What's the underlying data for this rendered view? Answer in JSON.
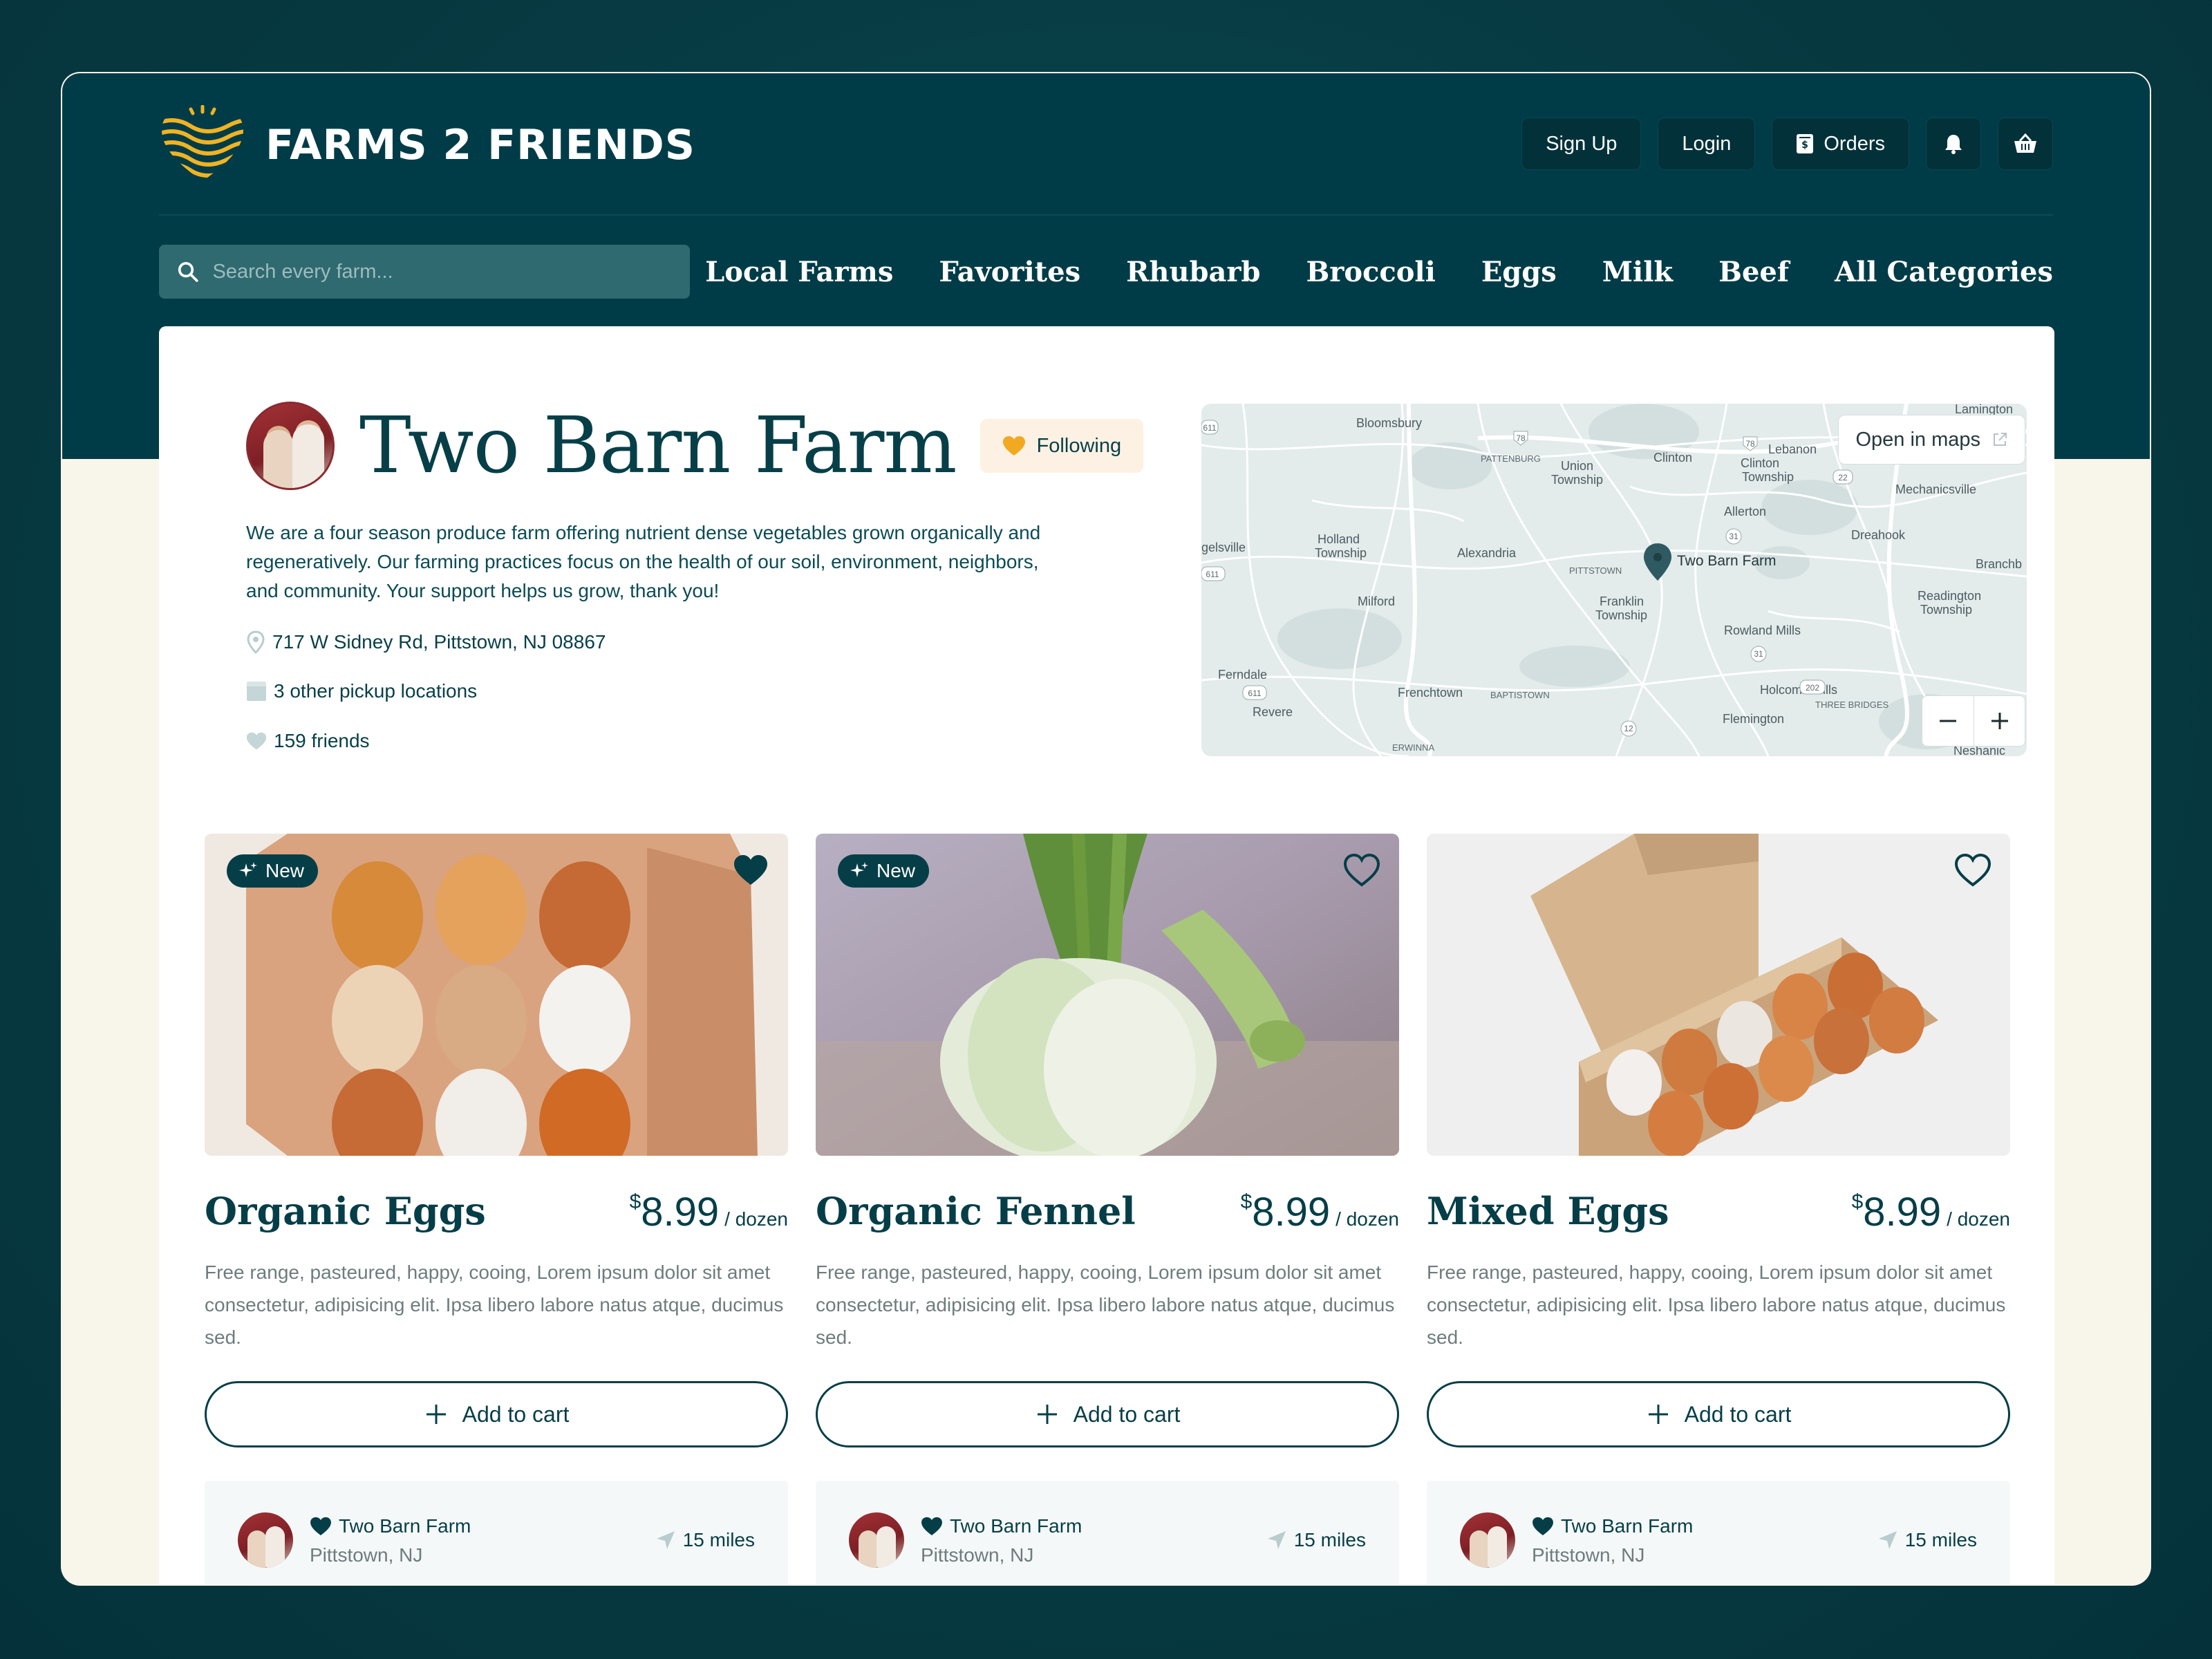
{
  "brand": {
    "name": "FARMS 2 FRIENDS"
  },
  "header": {
    "sign_up": "Sign Up",
    "login": "Login",
    "orders": "Orders",
    "icons": [
      "bell-icon",
      "basket-icon",
      "receipt-icon"
    ]
  },
  "search": {
    "placeholder": "Search every farm..."
  },
  "nav": {
    "items": [
      "Local Farms",
      "Favorites",
      "Rhubarb",
      "Broccoli",
      "Eggs",
      "Milk",
      "Beef",
      "All Categories"
    ]
  },
  "farm": {
    "name": "Two Barn Farm",
    "follow_label": "Following",
    "description": "We are a four season produce farm offering nutrient dense vegetables grown organically and regeneratively. Our farming practices focus on the health of our soil, environment, neighbors, and community. Your support helps us grow, thank you!",
    "address": "717 W Sidney Rd, Pittstown, NJ  08867",
    "pickup": "3 other pickup locations",
    "friends": "159 friends"
  },
  "map": {
    "open_label": "Open in maps",
    "marker_label": "Two Barn Farm",
    "places": [
      "Lamington",
      "Bloomsbury",
      "Lebanon",
      "Clinton",
      "Clinton Township",
      "Union Township",
      "PATTENBURG",
      "Mechanicsville",
      "Allerton",
      "Dreahook",
      "Holland Township",
      "Alexandria",
      "PITTSTOWN",
      "Branchburg",
      "Readington Township",
      "Milford",
      "Franklin Township",
      "Rowland Mills",
      "Ferndale",
      "Frenchtown",
      "BAPTISTOWN",
      "Holcomb Mills",
      "THREE BRIDGES",
      "Revere",
      "Flemington",
      "ERWINNA",
      "Neshanic",
      "gelsville"
    ],
    "route_numbers": [
      "78",
      "78",
      "22",
      "31",
      "31",
      "202",
      "611",
      "611",
      "12",
      "611"
    ]
  },
  "products": [
    {
      "name": "Organic Eggs",
      "currency": "$",
      "price": "8.99",
      "unit": "/ dozen",
      "badge": "New",
      "favorited": true,
      "description": "Free range, pasteured, happy, cooing, Lorem ipsum dolor sit amet consectetur, adipisicing elit. Ipsa libero labore natus atque, ducimus sed.",
      "cta": "Add to cart",
      "farm": "Two Barn Farm",
      "location": "Pittstown, NJ",
      "distance": "15 miles"
    },
    {
      "name": "Organic Fennel",
      "currency": "$",
      "price": "8.99",
      "unit": "/ dozen",
      "badge": "New",
      "favorited": false,
      "description": "Free range, pasteured, happy, cooing, Lorem ipsum dolor sit amet consectetur, adipisicing elit. Ipsa libero labore natus atque, ducimus sed.",
      "cta": "Add to cart",
      "farm": "Two Barn Farm",
      "location": "Pittstown, NJ",
      "distance": "15 miles"
    },
    {
      "name": "Mixed Eggs",
      "currency": "$",
      "price": "8.99",
      "unit": "/ dozen",
      "badge": "",
      "favorited": false,
      "description": "Free range, pasteured, happy, cooing, Lorem ipsum dolor sit amet consectetur, adipisicing elit. Ipsa libero labore natus atque, ducimus sed.",
      "cta": "Add to cart",
      "farm": "Two Barn Farm",
      "location": "Pittstown, NJ",
      "distance": "15 miles"
    }
  ],
  "colors": {
    "primary": "#003c47",
    "background_outer": "#073a42",
    "cream": "#f8f5ea",
    "accent_gold": "#e8a91e",
    "follow_bg": "#fdf1e3",
    "search_bg": "#2f6a70"
  }
}
